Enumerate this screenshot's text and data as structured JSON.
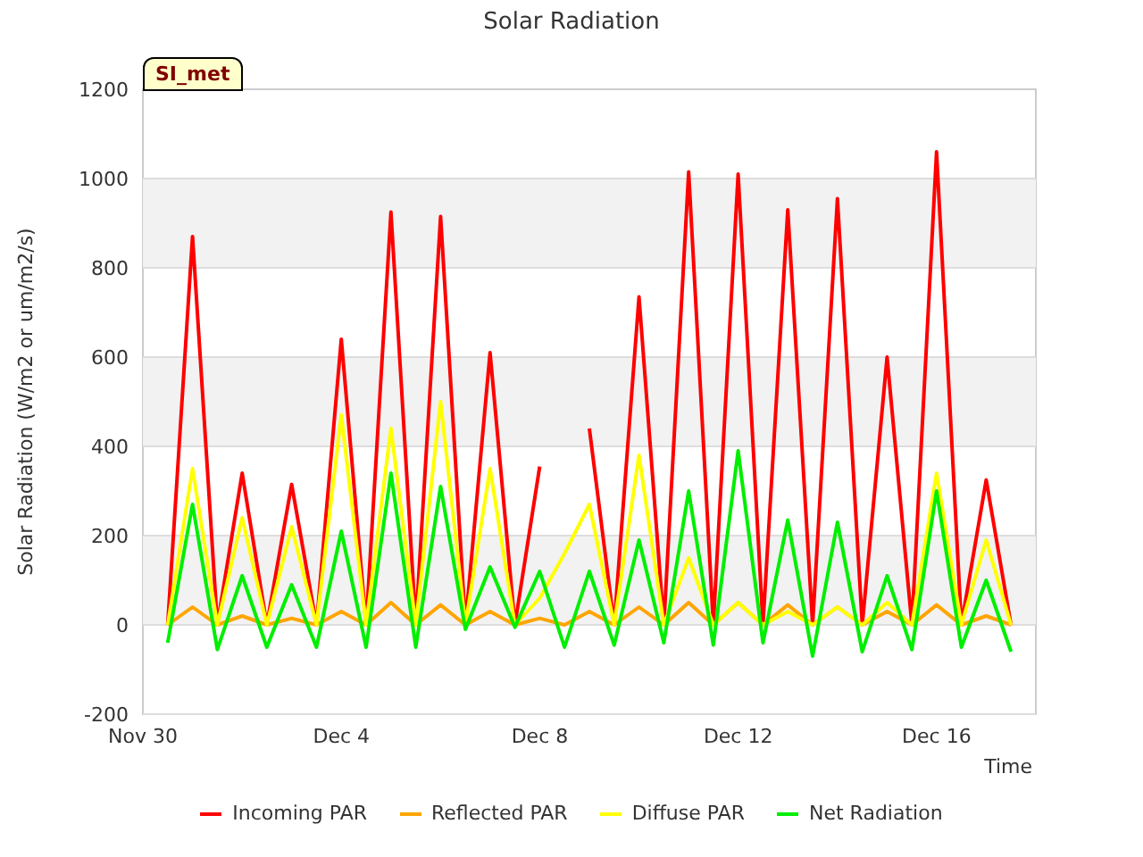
{
  "chart": {
    "badge": "SI_met",
    "chart_data": {
      "type": "line",
      "title": "Solar Radiation",
      "xlabel": "Time",
      "ylabel": "Solar Radiation (W/m2 or um/m2/s)",
      "categories": [
        "Nov 30",
        null,
        null,
        null,
        null,
        null,
        null,
        null,
        "Dec 4",
        null,
        null,
        null,
        null,
        null,
        null,
        null,
        "Dec 8",
        null,
        null,
        null,
        null,
        null,
        null,
        null,
        "Dec 12",
        null,
        null,
        null,
        null,
        null,
        null,
        null,
        "Dec 16",
        null,
        null,
        null
      ],
      "ylim": [
        -200,
        1200
      ],
      "grid": true,
      "legend": "bottom",
      "yticks": [
        -200,
        0,
        200,
        400,
        600,
        800,
        1000,
        1200
      ],
      "series": [
        {
          "name": "Incoming PAR",
          "color": "#ff0000",
          "values": [
            null,
            0,
            870,
            0,
            340,
            0,
            315,
            0,
            640,
            0,
            925,
            0,
            915,
            0,
            610,
            0,
            355,
            null,
            440,
            0,
            735,
            0,
            1015,
            0,
            1010,
            0,
            930,
            0,
            955,
            0,
            600,
            0,
            1060,
            0,
            325,
            0
          ]
        },
        {
          "name": "Reflected PAR",
          "color": "#ffa500",
          "values": [
            null,
            0,
            40,
            0,
            20,
            0,
            15,
            0,
            30,
            0,
            50,
            0,
            45,
            0,
            30,
            0,
            15,
            0,
            30,
            0,
            40,
            0,
            50,
            0,
            50,
            0,
            45,
            0,
            40,
            0,
            30,
            0,
            45,
            0,
            20,
            0
          ]
        },
        {
          "name": "Diffuse PAR",
          "color": "#ffff00",
          "values": [
            null,
            0,
            350,
            0,
            240,
            0,
            220,
            0,
            470,
            0,
            440,
            0,
            500,
            0,
            350,
            0,
            60,
            160,
            270,
            0,
            380,
            0,
            150,
            0,
            50,
            0,
            30,
            0,
            40,
            0,
            50,
            0,
            340,
            0,
            190,
            0
          ]
        },
        {
          "name": "Net Radiation",
          "color": "#00ee00",
          "values": [
            null,
            -40,
            270,
            -55,
            110,
            -50,
            90,
            -50,
            210,
            -50,
            340,
            -50,
            310,
            -10,
            130,
            -5,
            120,
            -50,
            120,
            -45,
            190,
            -40,
            300,
            -45,
            390,
            -40,
            235,
            -70,
            230,
            -60,
            110,
            -55,
            300,
            -50,
            100,
            -60
          ]
        }
      ]
    }
  }
}
